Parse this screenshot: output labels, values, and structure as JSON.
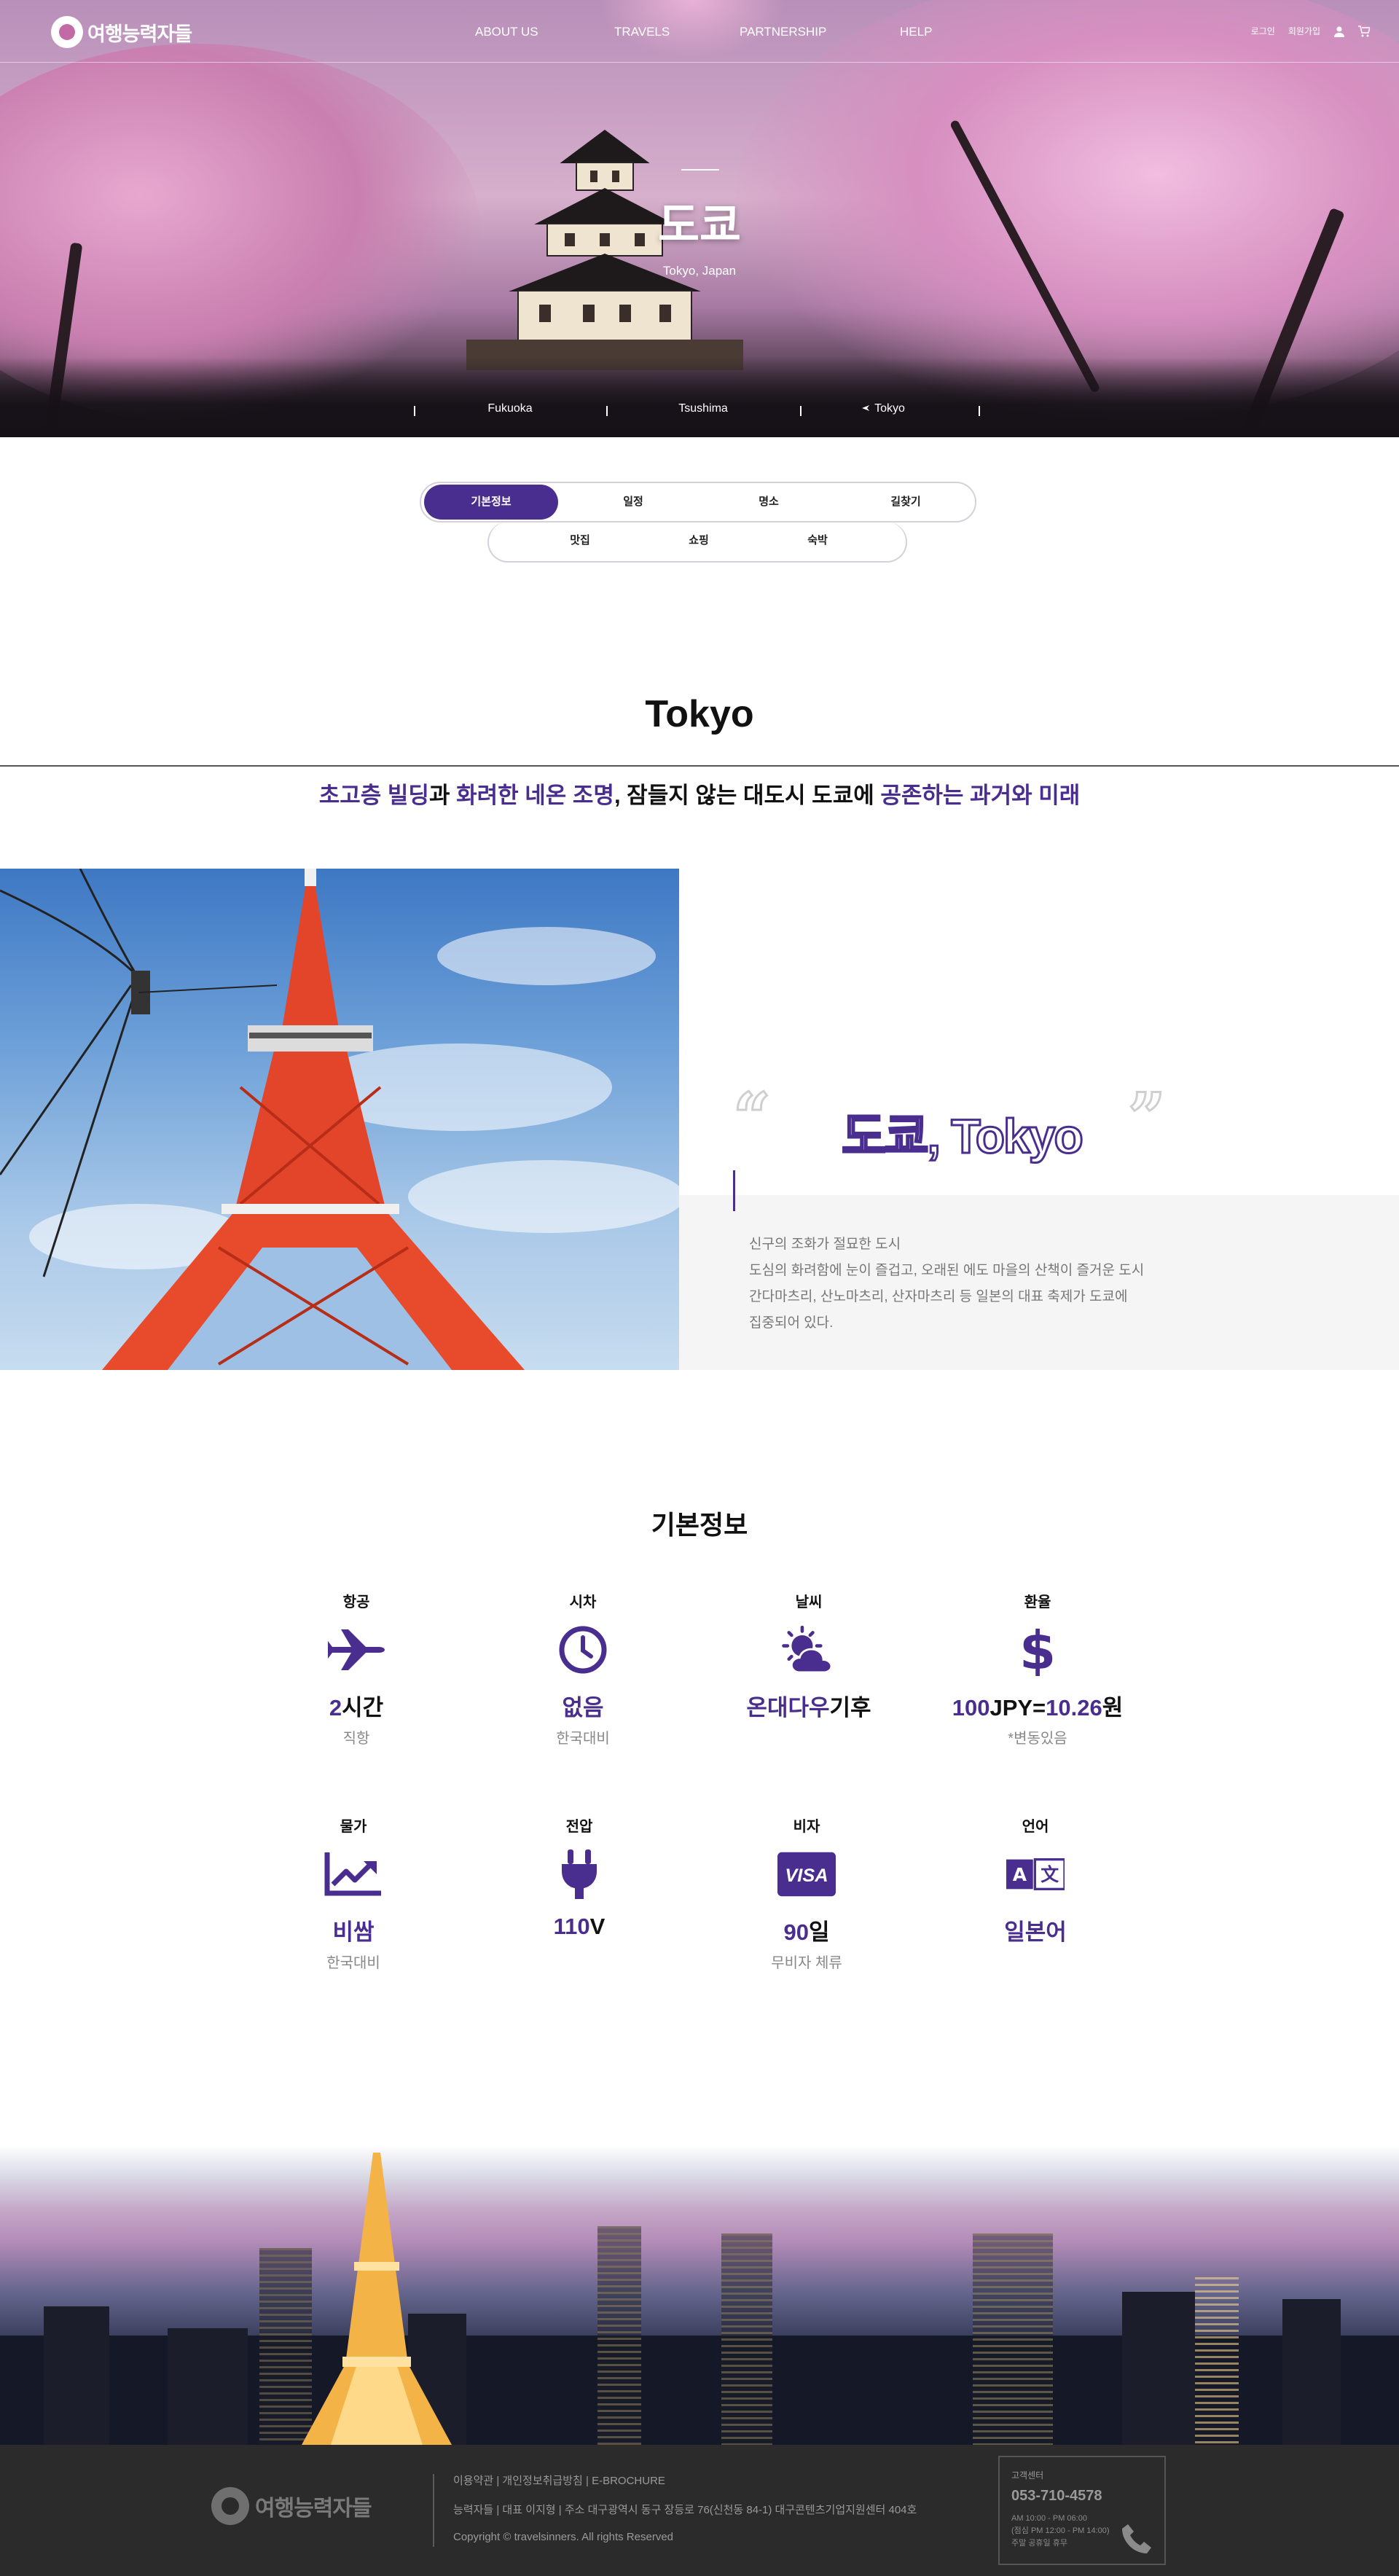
{
  "brand": {
    "name": "여행능력자들"
  },
  "nav": {
    "menu": [
      "ABOUT US",
      "TRAVELS",
      "PARTNERSHIP",
      "HELP"
    ],
    "login": "로그인",
    "signup": "회원가입"
  },
  "hero": {
    "title": "도쿄",
    "subtitle": "Tokyo, Japan",
    "breadcrumbs": [
      "Fukuoka",
      "Tsushima",
      "Tokyo"
    ]
  },
  "tabs": {
    "row1": [
      "기본정보",
      "일정",
      "명소",
      "길찾기"
    ],
    "row2": [
      "맛집",
      "쇼핑",
      "숙박"
    ],
    "active": "기본정보"
  },
  "intro": {
    "heading": "Tokyo",
    "tagline_parts": [
      {
        "text": "초고층 빌딩",
        "hl": true
      },
      {
        "text": "과 ",
        "hl": false
      },
      {
        "text": "화려한 네온 조명",
        "hl": true
      },
      {
        "text": ", 잠들지 않는 대도시 도쿄에 ",
        "hl": false
      },
      {
        "text": "공존하는 과거와 미래",
        "hl": true
      }
    ],
    "quote_title": "도쿄, Tokyo",
    "description": [
      "신구의 조화가 절묘한 도시",
      "도심의 화려함에 눈이 즐겁고, 오래된 에도 마을의 산책이 즐거운 도시",
      "간다마츠리, 산노마츠리, 산자마츠리 등 일본의 대표 축제가 도쿄에",
      "집중되어 있다."
    ]
  },
  "basic_info": {
    "heading": "기본정보",
    "items": [
      {
        "label": "항공",
        "icon": "airplane-icon",
        "value_hl": "2",
        "value_rest": "시간",
        "note": "직항"
      },
      {
        "label": "시차",
        "icon": "clock-icon",
        "value_hl": "없음",
        "value_rest": "",
        "note": "한국대비"
      },
      {
        "label": "날씨",
        "icon": "weather-icon",
        "value_hl": "온대다우",
        "value_rest": "기후",
        "note": ""
      },
      {
        "label": "환율",
        "icon": "dollar-icon",
        "value_hl": "100",
        "value_rest": "JPY=",
        "value_hl2": "10.26",
        "value_rest2": "원",
        "note": "*변동있음"
      },
      {
        "label": "물가",
        "icon": "chart-icon",
        "value_hl": "비쌈",
        "value_rest": "",
        "note": "한국대비"
      },
      {
        "label": "전압",
        "icon": "plug-icon",
        "value_hl": "110",
        "value_rest": "V",
        "note": ""
      },
      {
        "label": "비자",
        "icon": "visa-icon",
        "value_hl": "90",
        "value_rest": "일",
        "note": "무비자 체류"
      },
      {
        "label": "언어",
        "icon": "language-icon",
        "value_hl": "일본어",
        "value_rest": "",
        "note": ""
      }
    ]
  },
  "footer": {
    "links": "이용약관 | 개인정보취급방침 | E-BROCHURE",
    "company": "능력자들 | 대표 이지형 | 주소 대구광역시 동구 장등로 76(신천동 84-1) 대구콘텐츠기업지원센터 404호",
    "copyright": "Copyright © travelsinners. All rights Reserved",
    "cs_label": "고객센터",
    "cs_phone": "053-710-4578",
    "cs_hours": [
      "AM 10:00 - PM 06:00",
      "(점심 PM 12:00 - PM 14:00)",
      "주말 공휴일 휴무"
    ]
  },
  "colors": {
    "accent": "#4a2e8f",
    "footer_bg": "#2b2b2b"
  }
}
